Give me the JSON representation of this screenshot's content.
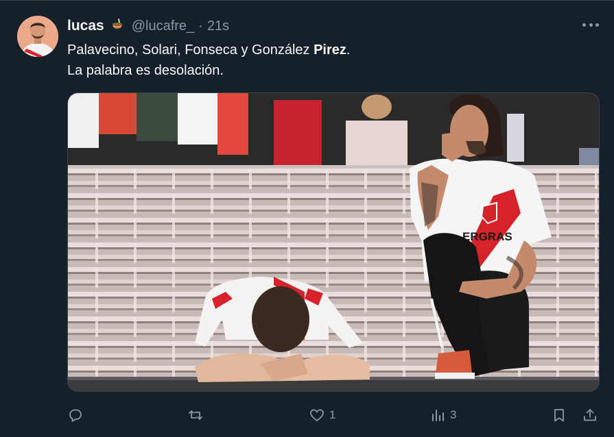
{
  "author": {
    "display_name": "lucas",
    "emoji_icon": "mate-cup-icon",
    "handle": "@lucafre_",
    "separator": "·",
    "time": "21s"
  },
  "text": {
    "line1_plain": "Palavecino, Solari, Fonseca y González ",
    "line1_bold": "Pirez",
    "line1_end": ".",
    "line2": "La palabra es desolación."
  },
  "media": {
    "alt_description": "River Plate fans grieving in empty stadium stands",
    "shirt_text": "ERGRAS"
  },
  "actions": {
    "reply": {
      "icon": "reply-icon",
      "count": ""
    },
    "retweet": {
      "icon": "retweet-icon",
      "count": ""
    },
    "like": {
      "icon": "heart-icon",
      "count": "1"
    },
    "views": {
      "icon": "views-icon",
      "count": "3"
    },
    "bookmark": {
      "icon": "bookmark-icon"
    },
    "share": {
      "icon": "share-icon"
    }
  },
  "colors": {
    "background": "#15202b",
    "text_primary": "#f7f9f9",
    "text_secondary": "#8b98a5",
    "border": "#38444d",
    "river_red": "#d6232b"
  }
}
